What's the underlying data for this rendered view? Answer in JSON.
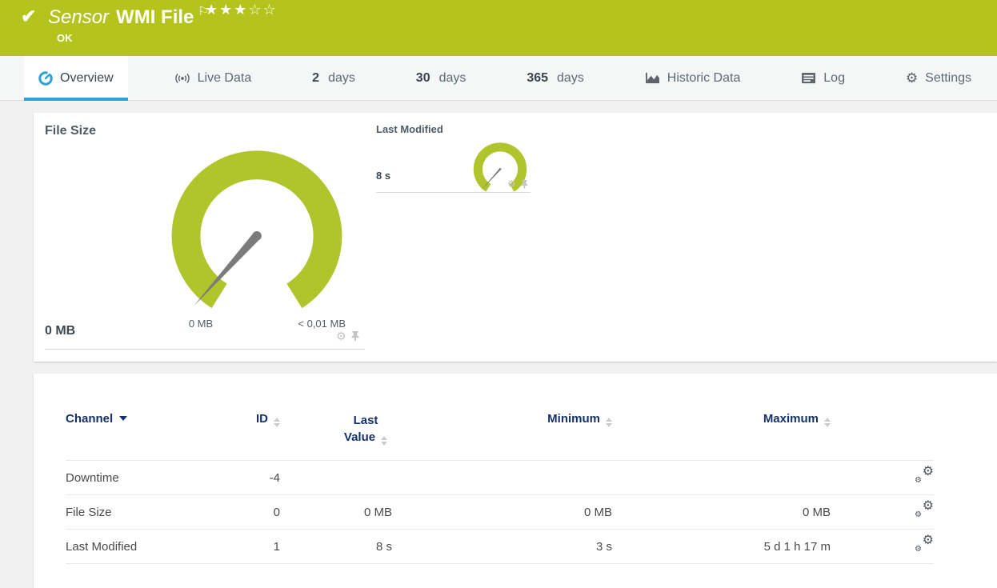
{
  "colors": {
    "banner_green": "#b5c31d",
    "gauge_green": "#b0c52c",
    "active_tab_blue": "#2da1d8",
    "table_header_navy": "#15316b"
  },
  "header": {
    "check_icon": "✔",
    "title_prefix": "Sensor",
    "title": "WMI File",
    "flag_icon": "⚐",
    "stars_filled": "★★★",
    "stars_empty": "☆☆",
    "rating": "3 of 5",
    "status": "OK"
  },
  "tabs": {
    "overview": {
      "label": "Overview"
    },
    "live_data": {
      "label": "Live Data"
    },
    "days2": {
      "number": "2",
      "label": "days"
    },
    "days30": {
      "number": "30",
      "label": "days"
    },
    "days365": {
      "number": "365",
      "label": "days"
    },
    "historic": {
      "label": "Historic Data"
    },
    "log": {
      "label": "Log"
    },
    "settings": {
      "label": "Settings"
    }
  },
  "gauges": {
    "file_size": {
      "title": "File Size",
      "value": "0 MB",
      "min_label": "0 MB",
      "max_label": "< 0,01 MB"
    },
    "last_modified": {
      "title": "Last Modified",
      "value": "8 s"
    }
  },
  "icons": {
    "gear": "⚙"
  },
  "table": {
    "headers": {
      "channel": "Channel",
      "id": "ID",
      "last_value": "Last Value",
      "minimum": "Minimum",
      "maximum": "Maximum"
    },
    "rows": [
      {
        "channel": "Downtime",
        "id": "-4",
        "last_value": "",
        "minimum": "",
        "maximum": ""
      },
      {
        "channel": "File Size",
        "id": "0",
        "last_value": "0 MB",
        "minimum": "0 MB",
        "maximum": "0 MB"
      },
      {
        "channel": "Last Modified",
        "id": "1",
        "last_value": "8 s",
        "minimum": "3 s",
        "maximum": "5 d 1 h 17 m"
      }
    ]
  }
}
